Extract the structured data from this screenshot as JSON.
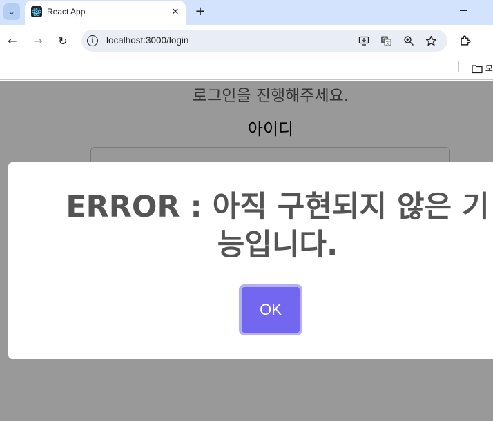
{
  "browser": {
    "tab_title": "React App",
    "url": "localhost:3000/login",
    "bookmark_folder_label": "모"
  },
  "page": {
    "login_heading": "로그인을 진행해주세요.",
    "id_label": "아이디"
  },
  "modal": {
    "message_line1": "ERROR : 아직 구현되지 않은 기",
    "message_line2": "능입니다.",
    "ok_label": "OK"
  }
}
